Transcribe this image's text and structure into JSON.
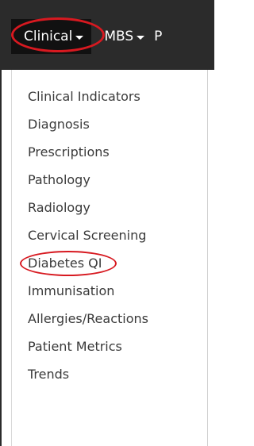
{
  "nav": {
    "items": [
      {
        "label": "Clinical"
      },
      {
        "label": "MBS"
      },
      {
        "label": "P"
      }
    ]
  },
  "dropdown": {
    "items": [
      {
        "label": "Clinical Indicators"
      },
      {
        "label": "Diagnosis"
      },
      {
        "label": "Prescriptions"
      },
      {
        "label": "Pathology"
      },
      {
        "label": "Radiology"
      },
      {
        "label": "Cervical Screening"
      },
      {
        "label": "Diabetes QI"
      },
      {
        "label": "Immunisation"
      },
      {
        "label": "Allergies/Reactions"
      },
      {
        "label": "Patient Metrics"
      },
      {
        "label": "Trends"
      }
    ]
  },
  "colors": {
    "navbar": "#2b2b2b",
    "active_nav": "#111111",
    "highlight": "#d71920",
    "menu_text": "#3a3a3a"
  },
  "icons": {
    "dropdown_caret": "caret-down-icon"
  }
}
